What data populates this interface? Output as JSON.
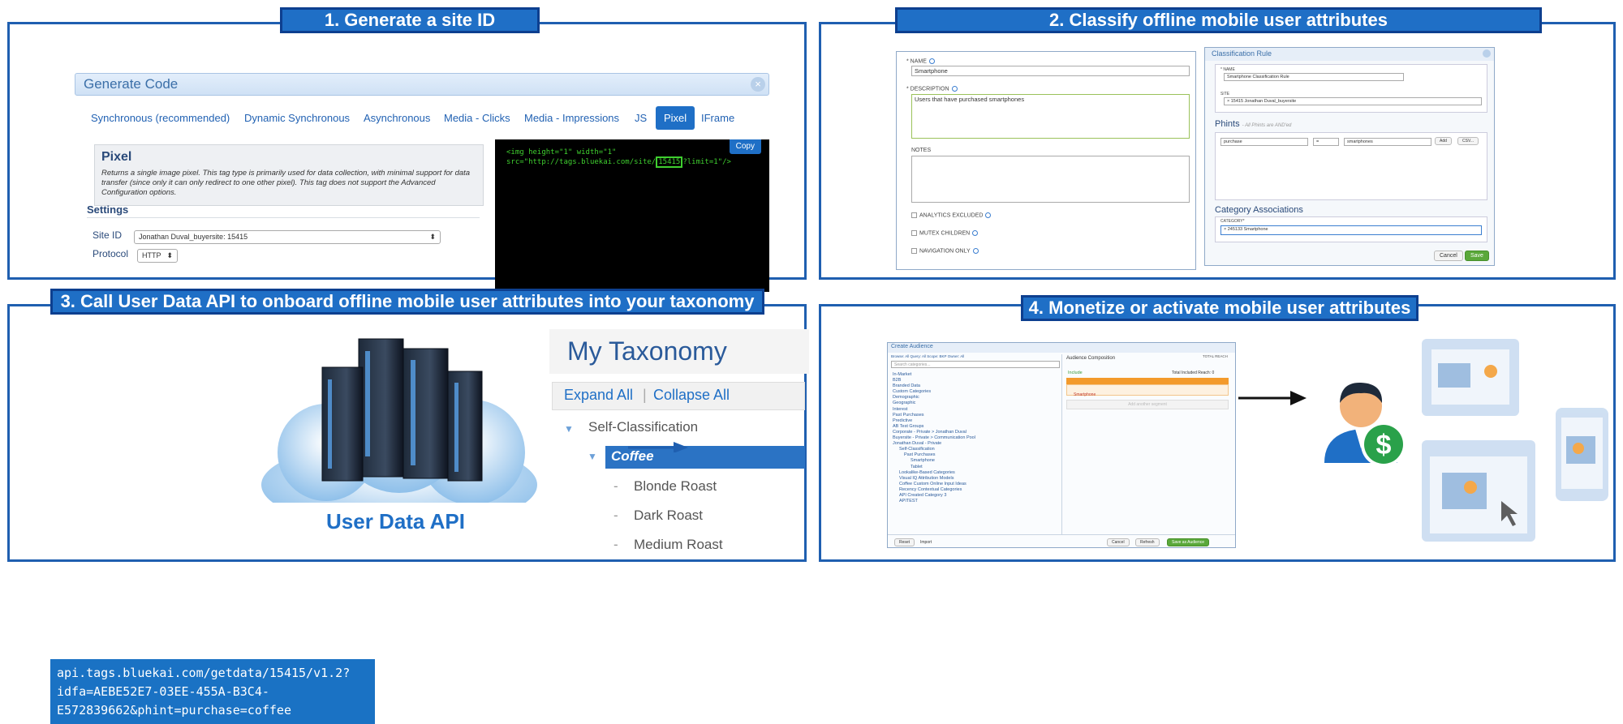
{
  "panel1": {
    "title": "1. Generate a site ID",
    "dialog_title": "Generate Code",
    "tabs": [
      "Synchronous (recommended)",
      "Dynamic Synchronous",
      "Asynchronous",
      "Media - Clicks",
      "Media - Impressions",
      "JS",
      "Pixel",
      "IFrame"
    ],
    "active_tab": "Pixel",
    "info_title": "Pixel",
    "info_text": "Returns a single image pixel. This tag type is primarily used for data collection, with minimal support for data transfer (since only it can only redirect to one other pixel). This tag does not support the Advanced Configuration options.",
    "settings_label": "Settings",
    "site_id_label": "Site ID",
    "site_id_value": "Jonathan Duval_buyersite: 15415",
    "protocol_label": "Protocol",
    "protocol_value": "HTTP",
    "copy_label": "Copy",
    "code_line1": "<img height=\"1\" width=\"1\"",
    "code_line2_pre": "src=\"http://tags.bluekai.com/site/",
    "code_site_id": "15415",
    "code_line2_post": "?limit=1\"/>"
  },
  "panel2": {
    "title": "2. Classify offline mobile user attributes",
    "name_label": "* NAME",
    "name_value": "Smartphone",
    "description_label": "* DESCRIPTION",
    "description_value": "Users that have purchased smartphones",
    "notes_label": "NOTES",
    "checkboxes": [
      "ANALYTICS EXCLUDED",
      "MUTEX CHILDREN",
      "NAVIGATION ONLY"
    ],
    "rule_title": "Classification Rule",
    "rule_name_label": "* NAME",
    "rule_name_value": "Smartphone Classification Rule",
    "rule_site_label": "SITE",
    "rule_site_value": "× 15415 Jonathan Duval_buyersite",
    "phints_title": "Phints",
    "phints_subtitle": "- All Phints are AND'ed",
    "phint_key": "purchase",
    "phint_op": "=",
    "phint_value": "smartphones",
    "add_label": "Add",
    "csv_label": "CSV...",
    "cat_assoc_title": "Category Associations",
    "category_label": "CATEGORY*",
    "category_value": "× 245133 Smartphone",
    "cancel_label": "Cancel",
    "save_label": "Save"
  },
  "panel3": {
    "title": "3. Call User Data API to onboard offline mobile user attributes into your taxonomy",
    "api_lines": [
      "api.tags.bluekai.com/getdata/15415/v1.2?",
      "idfa=AEBE52E7-03EE-455A-B3C4-",
      "E572839662&phint=purchase=coffee"
    ],
    "api_label": "User Data API",
    "tax_title": "My Taxonomy",
    "expand_label": "Expand All",
    "collapse_label": "Collapse All",
    "node_parent": "Self-Classification",
    "node_selected": "Coffee",
    "children": [
      "Blonde Roast",
      "Dark Roast",
      "Medium Roast"
    ]
  },
  "panel4": {
    "title": "4. Monetize or activate mobile user attributes",
    "dialog_title": "Create Audience",
    "browse_label": "Browse: All  Query: All  Scope: BKP  Owner: All",
    "search_placeholder": "Search categories...",
    "composition_label": "Audience Composition",
    "total_reach_label": "TOTAL REACH",
    "include_label": "Include",
    "included_reach_label": "Total Included Reach: 0",
    "row_label": "Smartphone",
    "add_another_label": "Add another segment",
    "tree_items": [
      "In-Market",
      "B2B",
      "Branded Data",
      "Custom Categories",
      "Demographic",
      "Geographic",
      "Interest",
      "Past Purchases",
      "Predictive",
      "AB Test Groups",
      "Corporate - Private > Jonathan Duval",
      "Buyersite - Private > Communication Pool",
      "Jonathan Duval - Private",
      "Self-Classification",
      "Past Purchases",
      "Smartphone",
      "Tablet",
      "Lookalike-Based Categories",
      "Visual IQ Attribution Models",
      "Coffee Custom Online Input Ideas",
      "Recency Contextual Categories",
      "API Created Category 3",
      "APITEST"
    ],
    "reset_label": "Reset",
    "import_label": "Import",
    "cancel_label": "Cancel",
    "refresh_label": "Refresh",
    "save_label": "Save as Audience"
  }
}
